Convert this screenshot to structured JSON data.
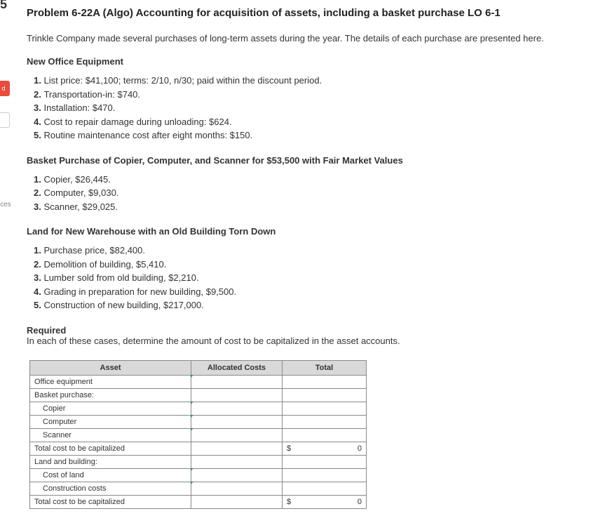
{
  "sidebar": {
    "top": "5",
    "red": "d",
    "ces": "ces"
  },
  "title": "Problem 6-22A (Algo) Accounting for acquisition of assets, including a basket purchase LO 6-1",
  "intro": "Trinkle Company made several purchases of long-term assets during the year. The details of each purchase are presented here.",
  "sec1_head": "New Office Equipment",
  "sec1": {
    "i1": "List price: $41,100; terms: 2/10, n/30; paid within the discount period.",
    "i2": "Transportation-in: $740.",
    "i3": "Installation: $470.",
    "i4": "Cost to repair damage during unloading: $624.",
    "i5": "Routine maintenance cost after eight months: $150."
  },
  "sec2_head": "Basket Purchase of Copier, Computer, and Scanner for $53,500 with Fair Market Values",
  "sec2": {
    "i1": "Copier, $26,445.",
    "i2": "Computer, $9,030.",
    "i3": "Scanner, $29,025."
  },
  "sec3_head": "Land for New Warehouse with an Old Building Torn Down",
  "sec3": {
    "i1": "Purchase price, $82,400.",
    "i2": "Demolition of building, $5,410.",
    "i3": "Lumber sold from old building, $2,210.",
    "i4": "Grading in preparation for new building, $9,500.",
    "i5": "Construction of new building, $217,000."
  },
  "req_label": "Required",
  "req_text": "In each of these cases, determine the amount of cost to be capitalized in the asset accounts.",
  "table": {
    "h_asset": "Asset",
    "h_alloc": "Allocated Costs",
    "h_total": "Total",
    "r_office": "Office equipment",
    "r_basket": "Basket purchase:",
    "r_copier": "Copier",
    "r_computer": "Computer",
    "r_scanner": "Scanner",
    "r_total1": "Total cost to be capitalized",
    "r_land": "Land and building:",
    "r_costland": "Cost of land",
    "r_constr": "Construction costs",
    "r_total2": "Total cost to be capitalized",
    "dollar": "$",
    "zero": "0"
  }
}
